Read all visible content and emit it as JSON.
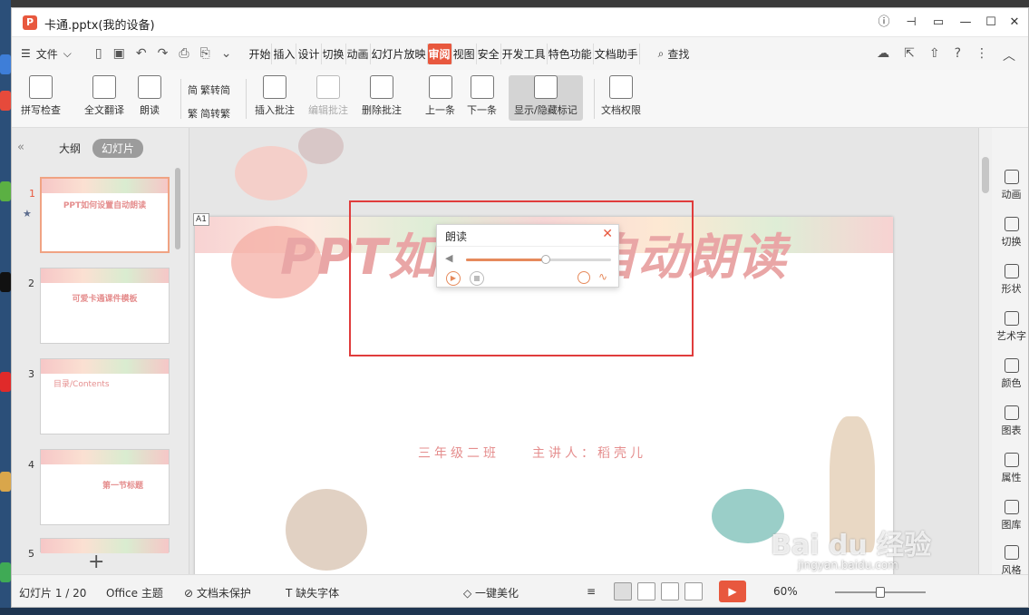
{
  "window": {
    "title": "卡通.pptx(我的设备)",
    "logo": "P"
  },
  "menubar": {
    "file_label": "文件",
    "tabs": [
      "开始",
      "插入",
      "设计",
      "切换",
      "动画",
      "幻灯片放映",
      "审阅",
      "视图",
      "安全",
      "开发工具",
      "特色功能",
      "文档助手"
    ],
    "active_tab": "审阅",
    "search_label": "查找"
  },
  "ribbon": {
    "spell_check": "拼写检查",
    "translate": "全文翻译",
    "read_aloud": "朗读",
    "trad_simp": "繁转简",
    "simp_trad": "简转繁",
    "insert_comment": "插入批注",
    "edit_comment": "编辑批注",
    "delete_comment": "删除批注",
    "prev": "上一条",
    "next": "下一条",
    "show_hide": "显示/隐藏标记",
    "doc_permission": "文档权限"
  },
  "leftpane": {
    "tab_outline": "大纲",
    "tab_slides": "幻灯片",
    "thumbs": [
      {
        "num": "1",
        "text": "PPT如何设置自动朗读"
      },
      {
        "num": "2",
        "text": "可爱卡通课件模板"
      },
      {
        "num": "3",
        "text": "目录/Contents"
      },
      {
        "num": "4",
        "text": "第一节标题"
      },
      {
        "num": "5",
        "text": ""
      }
    ]
  },
  "slide": {
    "id_label": "A1",
    "title": "PPT如何设置自动朗读",
    "subtitle": "三年级二班　　主讲人：稻壳儿"
  },
  "read_panel": {
    "title": "朗读",
    "volume": 0.55
  },
  "rightpane": {
    "items": [
      "动画",
      "切换",
      "形状",
      "艺术字",
      "颜色",
      "图表",
      "属性",
      "图库",
      "风格"
    ]
  },
  "status": {
    "slide_counter": "幻灯片 1 / 20",
    "theme": "Office 主题",
    "protect": "文档未保护",
    "missing_font": "缺失字体",
    "beautify": "一键美化",
    "zoom": "60%",
    "zoom_level": 0.5
  },
  "watermark": {
    "brand": "Bai du 经验",
    "url": "jingyan.baidu.com"
  }
}
